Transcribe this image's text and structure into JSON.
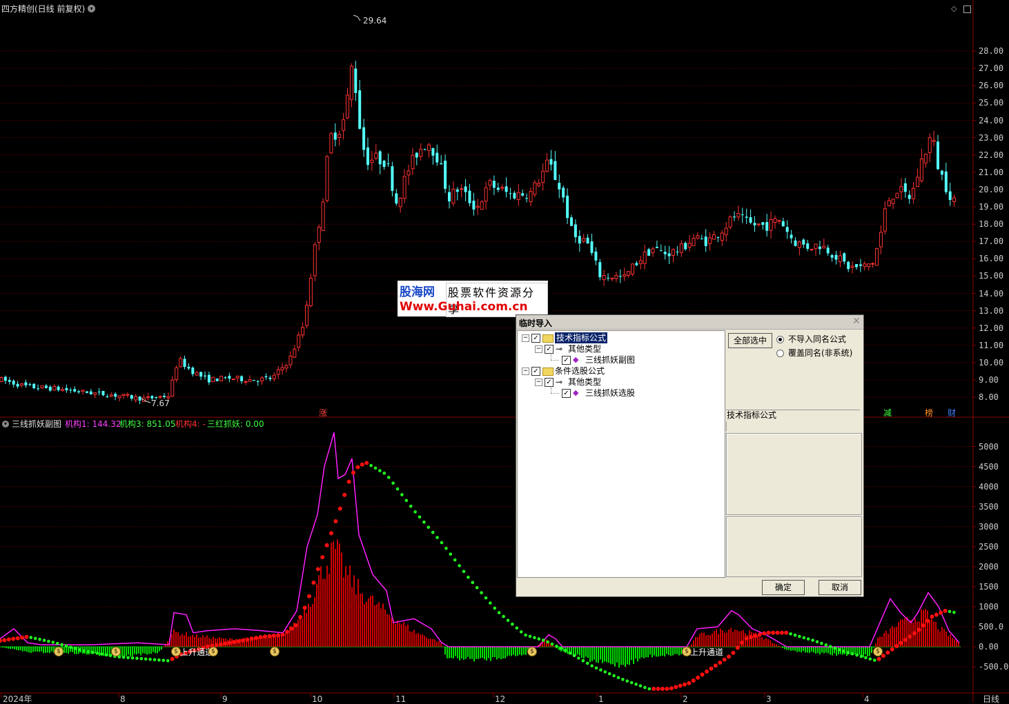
{
  "window": {
    "title": "四方精创(日线 前复权)",
    "period_label": "日线"
  },
  "colors": {
    "up": "#ff3232",
    "down": "#54ffff",
    "grid": "#8a0000",
    "magenta": "#ff20ff",
    "green_dot": "#20ff20",
    "red_dot": "#ff1010",
    "histogram_green": "#00e000",
    "histogram_red": "#d00000"
  },
  "main_chart": {
    "high_label": "29.64",
    "low_label": "7.67",
    "price_ticks": [
      "28.00",
      "27.00",
      "26.00",
      "25.00",
      "24.00",
      "23.00",
      "22.00",
      "21.00",
      "20.00",
      "19.00",
      "18.00",
      "17.00",
      "16.00",
      "15.00",
      "14.00",
      "13.00",
      "12.00",
      "11.00",
      "10.00",
      "9.00",
      "8.00"
    ],
    "markers": [
      {
        "text": "涨",
        "color": "#ff4040"
      },
      {
        "text": "减",
        "color": "#40ff40"
      },
      {
        "text": "榜",
        "color": "#ff9020"
      },
      {
        "text": "财",
        "color": "#4080ff"
      }
    ]
  },
  "sub_chart": {
    "name": "三线抓妖副图",
    "legend": [
      {
        "text": "机构1: 144.32",
        "color": "#ff40ff"
      },
      {
        "text": "机构3: 851.05",
        "color": "#40ff40"
      },
      {
        "text": "机构4: -",
        "color": "#ff3030"
      },
      {
        "text": "三红抓妖: 0.00",
        "color": "#40ff40"
      }
    ],
    "ticks": [
      "5000",
      "4500",
      "4000",
      "3500",
      "3000",
      "2500",
      "2000",
      "1500",
      "1000",
      "500.0",
      "0.00",
      "-500.0"
    ],
    "signal_text": "上升通道",
    "coin_icon_glyph": "$"
  },
  "time_axis": {
    "labels": [
      "2024年",
      "8",
      "9",
      "10",
      "11",
      "12",
      "1",
      "2",
      "3",
      "4"
    ]
  },
  "watermark": {
    "line1": "股海网",
    "line2": "股票软件资源分享",
    "line3": "Www.Guhai.com.cn"
  },
  "dialog": {
    "title": "临时导入",
    "tree": [
      {
        "label": "技术指标公式",
        "level": 0,
        "type": "folder",
        "checked": true,
        "selected": true
      },
      {
        "label": "其他类型",
        "level": 1,
        "type": "key",
        "checked": true
      },
      {
        "label": "三线抓妖副图",
        "level": 2,
        "type": "diamond",
        "checked": true
      },
      {
        "label": "条件选股公式",
        "level": 0,
        "type": "folder",
        "checked": true
      },
      {
        "label": "其他类型",
        "level": 1,
        "type": "key",
        "checked": true
      },
      {
        "label": "三线抓妖选股",
        "level": 2,
        "type": "diamond",
        "checked": true
      }
    ],
    "select_all_label": "全部选中",
    "radio_options": [
      {
        "label": "不导入同名公式",
        "selected": true
      },
      {
        "label": "覆盖同名(非系统)",
        "selected": false
      }
    ],
    "info_label": "技术指标公式",
    "ok_label": "确定",
    "cancel_label": "取消"
  }
}
